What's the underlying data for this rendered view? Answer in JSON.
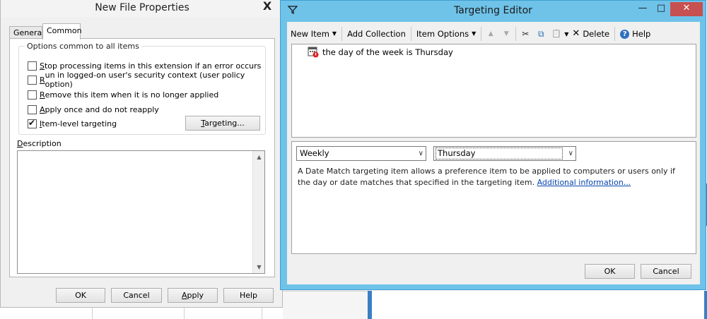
{
  "new_file_properties": {
    "title": "New File Properties",
    "close_symbol": "X",
    "tabs": [
      {
        "label": "General"
      },
      {
        "label": "Common"
      }
    ],
    "group_title": "Options common to all items",
    "options": [
      {
        "mnemonic": "S",
        "rest": "top processing items in this extension if an error occurs",
        "checked": false
      },
      {
        "mnemonic": "R",
        "rest": "un in logged-on user's security context (user policy option)",
        "checked": false
      },
      {
        "mnemonic": "R",
        "rest": "emove this item when it is no longer applied",
        "checked": false
      },
      {
        "mnemonic": "A",
        "rest": "pply once and do not reapply",
        "checked": false
      },
      {
        "mnemonic": "I",
        "rest": "tem-level targeting",
        "checked": true
      }
    ],
    "targeting_button": {
      "mnemonic": "T",
      "rest": "argeting..."
    },
    "description_label": {
      "mnemonic": "D",
      "rest": "escription"
    },
    "description_value": "",
    "buttons": {
      "ok": "OK",
      "cancel": "Cancel",
      "apply_mnemonic": "A",
      "apply_rest": "pply",
      "help": "Help"
    }
  },
  "targeting_editor": {
    "title": "Targeting Editor",
    "window_controls": {
      "minimize": "—",
      "maximize": "□",
      "close": "✕"
    },
    "toolbar": {
      "new_item": "New Item",
      "add_collection": "Add Collection",
      "item_options": "Item Options",
      "delete": "Delete",
      "help": "Help"
    },
    "icons": {
      "move_up": "▲",
      "move_down": "▼",
      "cut": "✂",
      "copy": "⧉",
      "paste": "📋",
      "delete": "✕",
      "help": "?"
    },
    "tree_items": [
      {
        "label": "the day of the week is Thursday",
        "icon": "calendar-icon"
      }
    ],
    "match_type": "Weekly",
    "day_value": "Thursday",
    "description_text": "A Date Match targeting item allows a preference item to be applied to computers or users only if the day or date matches that specified in the targeting item.",
    "additional_info_link": "Additional information...",
    "buttons": {
      "ok": "OK",
      "cancel": "Cancel"
    }
  },
  "colors": {
    "active_title": "#6fc2e8",
    "close_button": "#c75050",
    "link": "#0645ad"
  }
}
